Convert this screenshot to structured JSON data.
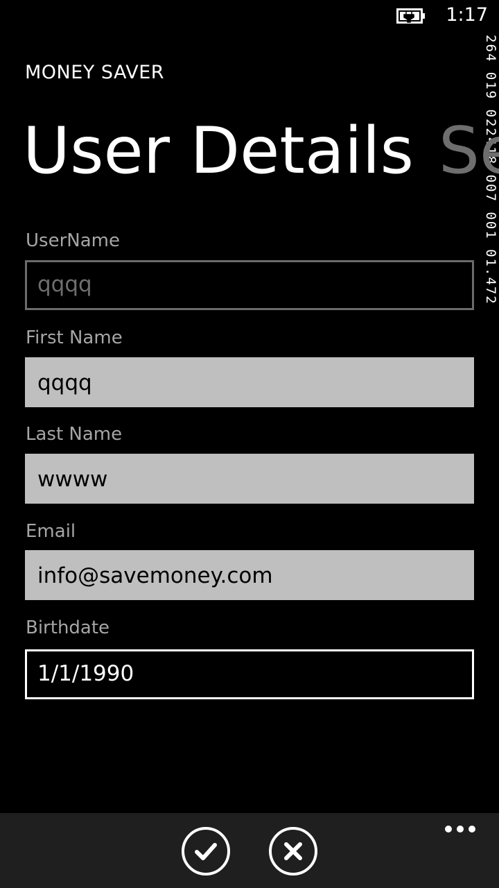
{
  "status_bar": {
    "time": "1:17",
    "battery_icon": "battery-charging-icon"
  },
  "debug_counter": "264 019 022418 007 001 01.472",
  "app": {
    "title": "MONEY SAVER"
  },
  "pivot": {
    "current": "User Details",
    "next": "Se"
  },
  "form": {
    "username": {
      "label": "UserName",
      "value": "qqqq"
    },
    "first_name": {
      "label": "First Name",
      "value": "qqqq"
    },
    "last_name": {
      "label": "Last Name",
      "value": "wwww"
    },
    "email": {
      "label": "Email",
      "value": "info@savemoney.com"
    },
    "birthdate": {
      "label": "Birthdate",
      "value": "1/1/1990"
    }
  },
  "app_bar": {
    "buttons": [
      {
        "icon": "check-icon"
      },
      {
        "icon": "close-icon"
      }
    ],
    "more_icon": "more-icon"
  },
  "colors": {
    "background": "#000000",
    "field_fill": "#bfbfbf",
    "label": "#a6a6a6",
    "app_bar": "#1f1f1f",
    "disabled": "#6e6e6e"
  }
}
